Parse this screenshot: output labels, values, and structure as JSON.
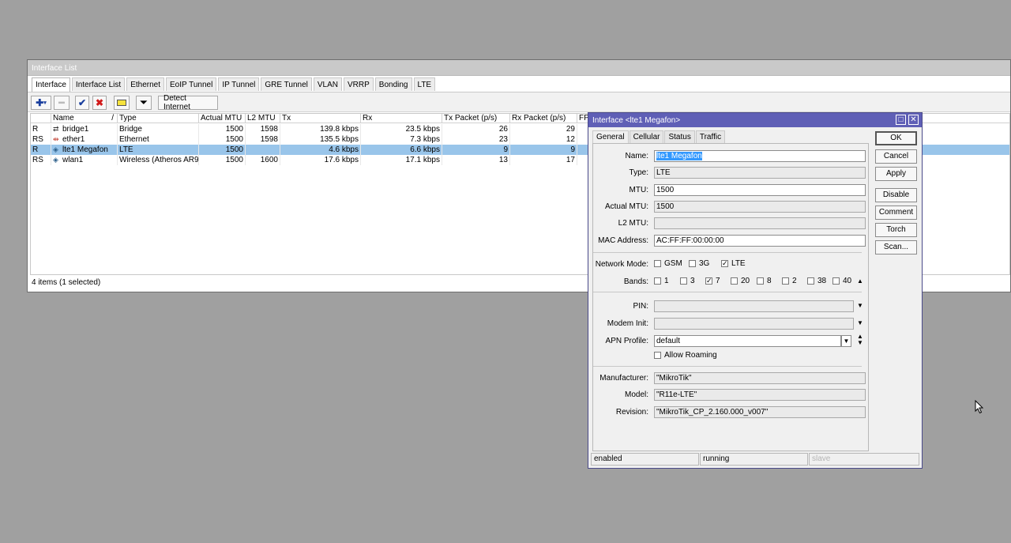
{
  "window": {
    "title": "Interface List",
    "tabs": [
      "Interface",
      "Interface List",
      "Ethernet",
      "EoIP Tunnel",
      "IP Tunnel",
      "GRE Tunnel",
      "VLAN",
      "VRRP",
      "Bonding",
      "LTE"
    ],
    "toolbar": {
      "detect_internet": "Detect Internet"
    },
    "columns": [
      "Name",
      "Type",
      "Actual MTU",
      "L2 MTU",
      "Tx",
      "Rx",
      "Tx Packet (p/s)",
      "Rx Packet (p/s)",
      "FP"
    ],
    "rows": [
      {
        "flags": "R",
        "name": "bridge1",
        "type": "Bridge",
        "mtu": "1500",
        "l2mtu": "1598",
        "tx": "139.8 kbps",
        "rx": "23.5 kbps",
        "txp": "26",
        "rxp": "29"
      },
      {
        "flags": "RS",
        "name": "ether1",
        "type": "Ethernet",
        "mtu": "1500",
        "l2mtu": "1598",
        "tx": "135.5 kbps",
        "rx": "7.3 kbps",
        "txp": "23",
        "rxp": "12"
      },
      {
        "flags": "R",
        "name": "lte1 Megafon",
        "type": "LTE",
        "mtu": "1500",
        "l2mtu": "",
        "tx": "4.6 kbps",
        "rx": "6.6 kbps",
        "txp": "9",
        "rxp": "9"
      },
      {
        "flags": "RS",
        "name": "wlan1",
        "type": "Wireless (Atheros AR9...",
        "mtu": "1500",
        "l2mtu": "1600",
        "tx": "17.6 kbps",
        "rx": "17.1 kbps",
        "txp": "13",
        "rxp": "17"
      }
    ],
    "status": "4 items (1 selected)"
  },
  "dialog": {
    "title": "Interface <lte1 Megafon>",
    "tabs": [
      "General",
      "Cellular",
      "Status",
      "Traffic"
    ],
    "labels": {
      "name": "Name:",
      "type": "Type:",
      "mtu": "MTU:",
      "actual_mtu": "Actual MTU:",
      "l2mtu": "L2 MTU:",
      "mac": "MAC Address:",
      "network_mode": "Network Mode:",
      "bands": "Bands:",
      "pin": "PIN:",
      "modem_init": "Modem Init:",
      "apn_profile": "APN Profile:",
      "manufacturer": "Manufacturer:",
      "model": "Model:",
      "revision": "Revision:"
    },
    "values": {
      "name": "lte1 Megafon",
      "type": "LTE",
      "mtu": "1500",
      "actual_mtu": "1500",
      "l2mtu": "",
      "mac": "AC:FF:FF:00:00:00",
      "pin": "",
      "modem_init": "",
      "apn_profile": "default",
      "manufacturer": "\"MikroTik\"",
      "model": "\"R11e-LTE\"",
      "revision": "\"MikroTik_CP_2.160.000_v007\""
    },
    "network_modes": [
      {
        "label": "GSM",
        "checked": false
      },
      {
        "label": "3G",
        "checked": false
      },
      {
        "label": "LTE",
        "checked": true
      }
    ],
    "bands": [
      {
        "label": "1",
        "checked": false
      },
      {
        "label": "3",
        "checked": false
      },
      {
        "label": "7",
        "checked": true
      },
      {
        "label": "20",
        "checked": false
      },
      {
        "label": "8",
        "checked": false
      },
      {
        "label": "2",
        "checked": false
      },
      {
        "label": "38",
        "checked": false
      },
      {
        "label": "40",
        "checked": false
      }
    ],
    "allow_roaming": {
      "label": "Allow Roaming",
      "checked": false
    },
    "buttons": {
      "ok": "OK",
      "cancel": "Cancel",
      "apply": "Apply",
      "disable": "Disable",
      "comment": "Comment",
      "torch": "Torch",
      "scan": "Scan..."
    },
    "status": {
      "enabled": "enabled",
      "running": "running",
      "slave": "slave"
    }
  }
}
